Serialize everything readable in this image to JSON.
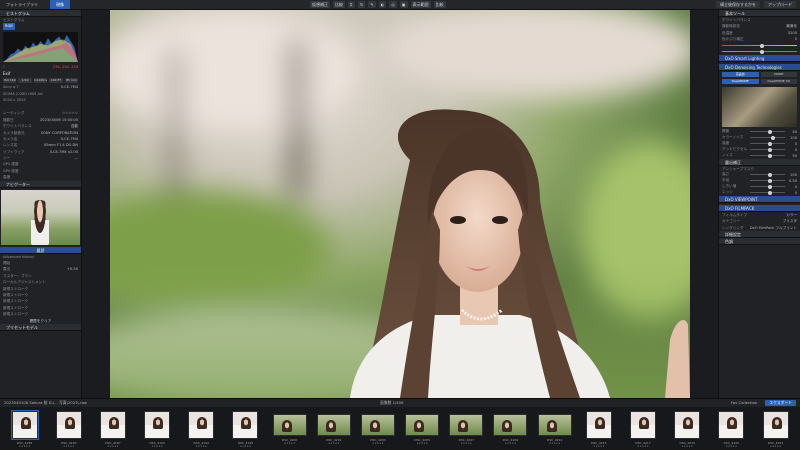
{
  "topbar": {
    "tab_library": "フォトライブラリ",
    "tab_develop": "現像",
    "tools": [
      "仮想補正",
      "比較"
    ],
    "view_label": "表示範囲",
    "compare_label": "比較",
    "right_buttons": [
      "構立後保存するかを",
      "アップロード"
    ]
  },
  "left": {
    "histogram_title": "ヒストグラム",
    "histogram_subtitle": "ヒストグラム",
    "rgb_button": "RGB",
    "readout": "234, 234, 234",
    "exif_header": "Exif",
    "buttons": [
      "ISO 160",
      "1/10",
      "1/1000 s",
      "100 ET",
      "85 mm"
    ],
    "camera_rows": [
      {
        "k": "Sony α 7",
        "v": "ILCE-7M4"
      },
      {
        "k": "SIGMA 2.0DG HSM Art",
        "v": ""
      },
      {
        "k": "3024 x 3024",
        "v": ""
      }
    ],
    "meta_rows": [
      {
        "k": "レーティング",
        "v": "☆☆☆☆☆"
      },
      {
        "k": "撮影日",
        "v": "2023/04/06 15:00:00"
      },
      {
        "k": "ホワイトバランス",
        "v": "自動"
      },
      {
        "k": "カメラ製造元",
        "v": "SONY CORPORATION"
      },
      {
        "k": "カメラ名",
        "v": "ILCE-7M4"
      },
      {
        "k": "レンズ名",
        "v": "85mm F1.4 DG DN"
      },
      {
        "k": "ソフトウェア",
        "v": "ILCE-7M4 v2.00"
      },
      {
        "k": "ジー",
        "v": "—"
      },
      {
        "k": "GPS 緯度",
        "v": ""
      },
      {
        "k": "GPS 経度",
        "v": ""
      },
      {
        "k": "高度",
        "v": ""
      }
    ],
    "navigator_title": "ナビゲーター",
    "history_tab": "履歴",
    "advanced_history": "Advanced history",
    "history_rows": [
      {
        "k": "開始",
        "v": ""
      },
      {
        "k": "露出",
        "v": "+0.50"
      },
      {
        "k": "マスター：ブラシ",
        "v": ""
      },
      {
        "k": "ローカルアジャストメント",
        "v": ""
      },
      {
        "k": "新規ストローク",
        "v": ""
      },
      {
        "k": "新規ストローク",
        "v": ""
      },
      {
        "k": "新規ストローク",
        "v": ""
      },
      {
        "k": "新規ストローク",
        "v": ""
      },
      {
        "k": "新規ストローク",
        "v": ""
      }
    ],
    "bottom_button": "履歴をクリア",
    "bottom_header": "プリセットモデル"
  },
  "right": {
    "section1": "基本ツール",
    "section1_sub": "ホワイトバランス",
    "wb_rows": [
      {
        "k": "撮影時設定",
        "v": "最適化"
      },
      {
        "k": "色温度",
        "v": "5200"
      },
      {
        "k": "色かぶり補正",
        "v": "0"
      }
    ],
    "section2": "DxO Smart Lighting",
    "section3": "DxO Denoising Technologies",
    "denoise_tabs": [
      "高品質",
      "PRIME",
      "DeepPRIME",
      "DeepPRIME XD"
    ],
    "sliders": [
      {
        "k": "輝度",
        "v": "40",
        "pos": 0.5
      },
      {
        "k": "カラーノイズ",
        "v": "100",
        "pos": 0.6
      },
      {
        "k": "強度",
        "v": "0",
        "pos": 0.5
      },
      {
        "k": "デッドピクセル",
        "v": "0",
        "pos": 0.5
      },
      {
        "k": "ノイズ",
        "v": "50",
        "pos": 0.5
      }
    ],
    "section4": "露出補正",
    "section5": "アンシャープマスク",
    "sliders2": [
      {
        "k": "強さ",
        "v": "100",
        "pos": 0.5
      },
      {
        "k": "半径",
        "v": "0.50",
        "pos": 0.5
      },
      {
        "k": "しきい値",
        "v": "4",
        "pos": 0.5
      },
      {
        "k": "エッジ",
        "v": "0",
        "pos": 0.5
      }
    ],
    "section6": "DxO VIEWPOINT",
    "section7": "DxO FILMPACK",
    "film_rows": [
      {
        "k": "フィルムタイプ",
        "v": "カラー"
      },
      {
        "k": "カテゴリー",
        "v": "ブリスタ"
      },
      {
        "k": "レンダリング",
        "v": "DxO FilmPack フルプリント"
      }
    ],
    "section8": "詳細設定",
    "section9": "色調"
  },
  "strip": {
    "path": "2023040106 Sakura 桜 D:\\... 写真\\2023\\.raw",
    "count": "1/406",
    "count_label": "画像数",
    "collection": "Fav Collection",
    "export_button": "エクスポート",
    "thumbs": [
      {
        "name": "DSC_4185",
        "meta": "★★★★★",
        "wide": false
      },
      {
        "name": "DSC_4180",
        "meta": "★★★★★",
        "wide": false
      },
      {
        "name": "DSC_4187",
        "meta": "★★★★★",
        "wide": false
      },
      {
        "name": "DSC_4190",
        "meta": "★★★★★",
        "wide": false
      },
      {
        "name": "DSC_4192",
        "meta": "★★★★★",
        "wide": false
      },
      {
        "name": "DSC_4196",
        "meta": "★★★★★",
        "wide": false
      },
      {
        "name": "DSC_4200",
        "meta": "★★★★★",
        "wide": true
      },
      {
        "name": "DSC_4201",
        "meta": "★★★★★",
        "wide": true
      },
      {
        "name": "DSC_4203",
        "meta": "★★★★★",
        "wide": true
      },
      {
        "name": "DSC_4205",
        "meta": "★★★★★",
        "wide": true
      },
      {
        "name": "DSC_4207",
        "meta": "★★★★★",
        "wide": true
      },
      {
        "name": "DSC_4209",
        "meta": "★★★★★",
        "wide": true
      },
      {
        "name": "DSC_4212",
        "meta": "★★★★★",
        "wide": true
      },
      {
        "name": "DSC_4215",
        "meta": "★★★★★",
        "wide": false
      },
      {
        "name": "DSC_4217",
        "meta": "★★★★★",
        "wide": false
      },
      {
        "name": "DSC_4219",
        "meta": "★★★★★",
        "wide": false
      },
      {
        "name": "DSC_4220",
        "meta": "★★★★★",
        "wide": false
      },
      {
        "name": "DSC_4222",
        "meta": "★★★★★",
        "wide": false
      }
    ]
  },
  "colors": {
    "accent": "#2f5fb0",
    "panel": "#202226",
    "background": "#1b1c1f"
  }
}
